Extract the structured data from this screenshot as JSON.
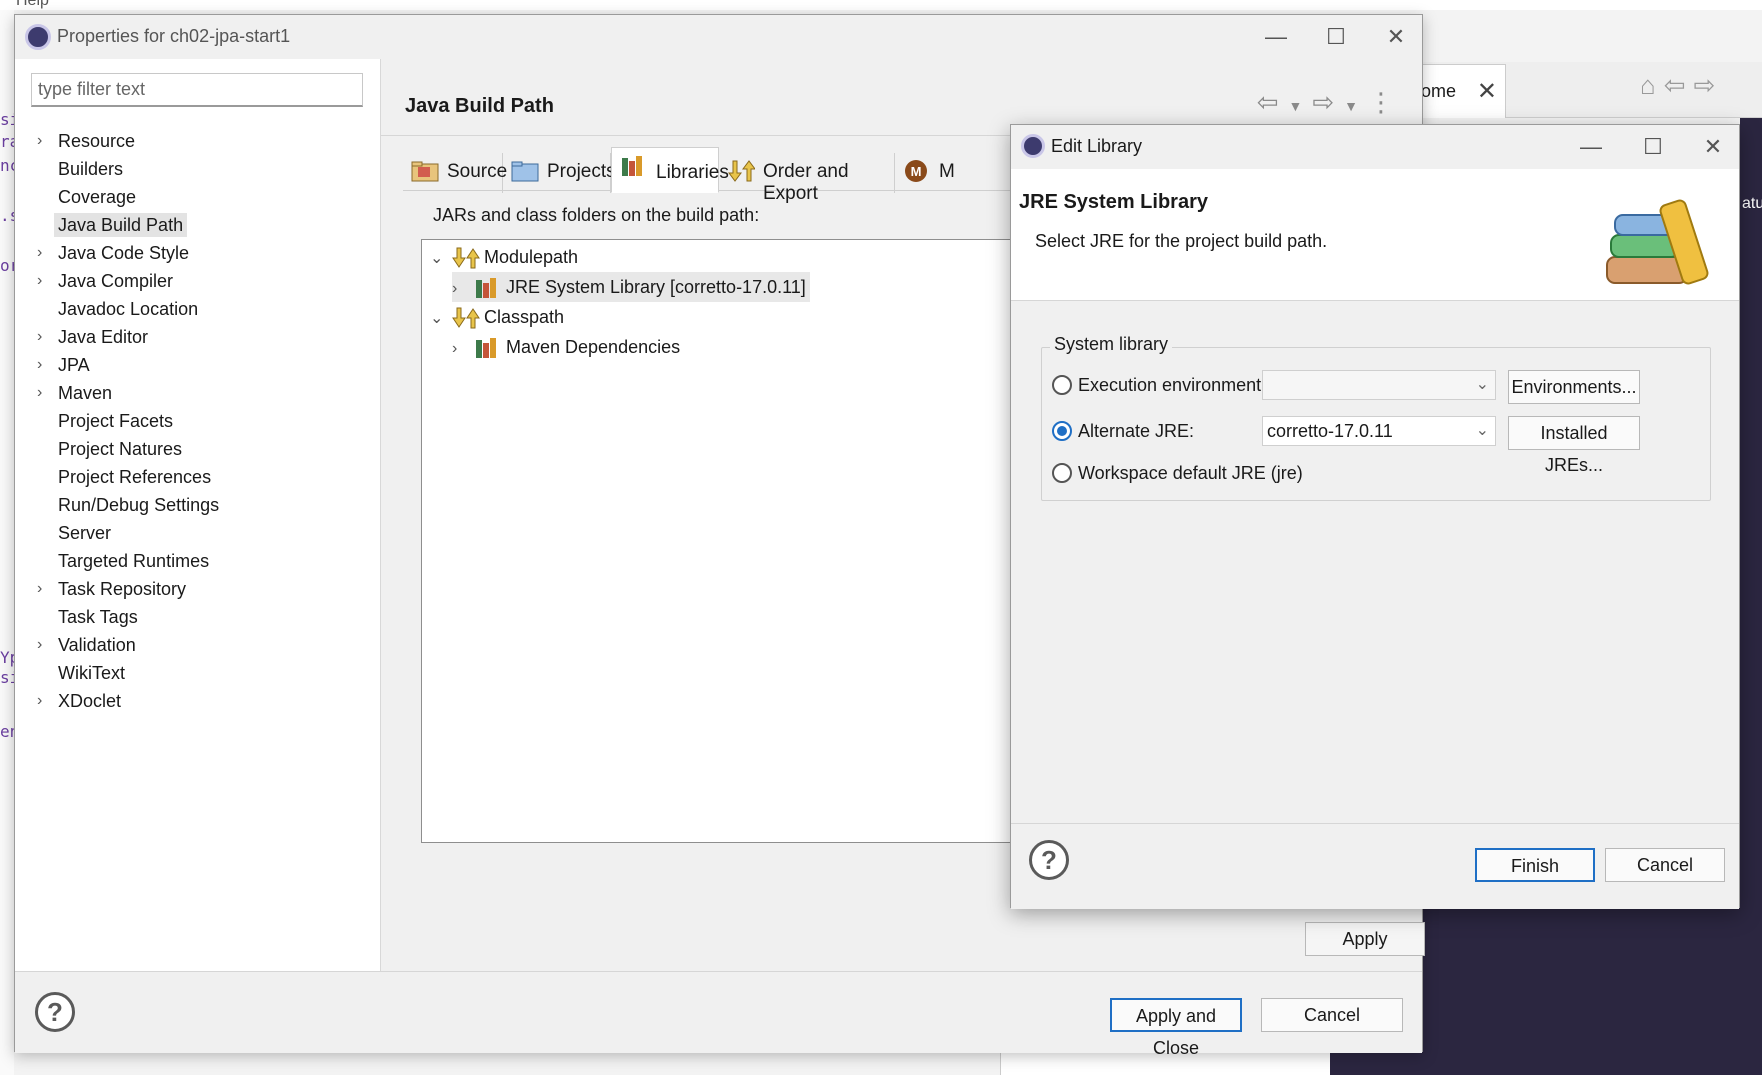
{
  "background": {
    "menu_text": "Help",
    "welcome_tab_label": "ome",
    "dark_panel_text": "atur"
  },
  "properties_dialog": {
    "title": "Properties for ch02-jpa-start1",
    "filter_placeholder": "type filter text",
    "nav_items": [
      {
        "label": "Resource",
        "expandable": true
      },
      {
        "label": "Builders",
        "expandable": false
      },
      {
        "label": "Coverage",
        "expandable": false
      },
      {
        "label": "Java Build Path",
        "expandable": false,
        "selected": true
      },
      {
        "label": "Java Code Style",
        "expandable": true
      },
      {
        "label": "Java Compiler",
        "expandable": true
      },
      {
        "label": "Javadoc Location",
        "expandable": false
      },
      {
        "label": "Java Editor",
        "expandable": true
      },
      {
        "label": "JPA",
        "expandable": true
      },
      {
        "label": "Maven",
        "expandable": true
      },
      {
        "label": "Project Facets",
        "expandable": false
      },
      {
        "label": "Project Natures",
        "expandable": false
      },
      {
        "label": "Project References",
        "expandable": false
      },
      {
        "label": "Run/Debug Settings",
        "expandable": false
      },
      {
        "label": "Server",
        "expandable": false
      },
      {
        "label": "Targeted Runtimes",
        "expandable": false
      },
      {
        "label": "Task Repository",
        "expandable": true
      },
      {
        "label": "Task Tags",
        "expandable": false
      },
      {
        "label": "Validation",
        "expandable": true
      },
      {
        "label": "WikiText",
        "expandable": false
      },
      {
        "label": "XDoclet",
        "expandable": true
      }
    ],
    "page_title": "Java Build Path",
    "tabs": [
      {
        "label": "Source",
        "icon": "source-folder-icon"
      },
      {
        "label": "Projects",
        "icon": "projects-folder-icon"
      },
      {
        "label": "Libraries",
        "icon": "libraries-icon",
        "active": true
      },
      {
        "label": "Order and Export",
        "icon": "order-export-icon"
      },
      {
        "label": "M",
        "icon": "maven-icon"
      }
    ],
    "libraries_caption": "JARs and class folders on the build path:",
    "tree": {
      "modulepath_label": "Modulepath",
      "jre_label": "JRE System Library [corretto-17.0.11]",
      "classpath_label": "Classpath",
      "maven_label": "Maven Dependencies"
    },
    "apply_label": "Apply",
    "apply_close_label": "Apply and Close",
    "cancel_label": "Cancel",
    "help_label": "?"
  },
  "edit_library_dialog": {
    "title": "Edit Library",
    "header_title": "JRE System Library",
    "header_description": "Select JRE for the project build path.",
    "group_label": "System library",
    "options": {
      "execution_env_label": "Execution environment:",
      "execution_env_value": "",
      "environments_button": "Environments...",
      "alternate_jre_label": "Alternate JRE:",
      "alternate_jre_value": "corretto-17.0.11",
      "installed_jres_button": "Installed JREs...",
      "workspace_default_label": "Workspace default JRE (jre)",
      "selected": "alternate_jre"
    },
    "finish_label": "Finish",
    "cancel_label": "Cancel",
    "help_label": "?"
  },
  "colors": {
    "accent": "#1f6fc5",
    "dark_panel": "#2b2640"
  }
}
